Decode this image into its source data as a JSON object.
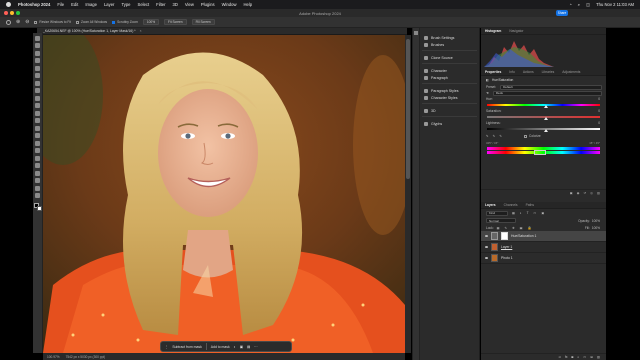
{
  "menubar": {
    "app": "Photoshop 2024",
    "items": [
      "File",
      "Edit",
      "Image",
      "Layer",
      "Type",
      "Select",
      "Filter",
      "3D",
      "View",
      "Plugins",
      "Window",
      "Help"
    ],
    "datetime": "Thu Nov 2  11:03 AM"
  },
  "window": {
    "title": "Adobe Photoshop 2024",
    "share_label": "Share"
  },
  "options_bar": {
    "resize_windows": "Resize Windows to Fit",
    "zoom_all_windows": "Zoom All Windows",
    "scrubby_zoom": "Scrubby Zoom",
    "zoom_value": "100%",
    "fit_screen": "Fit Screen",
    "fill_screen": "Fill Screen"
  },
  "document_tab": {
    "label": "_KA20654.NEF @ 100% (Hue/Saturation 1, Layer Mask/16) *"
  },
  "left_panels": [
    {
      "label": "Brush Settings",
      "icon": "brush-settings-icon"
    },
    {
      "label": "Brushes",
      "icon": "brushes-icon"
    },
    {
      "label": "Clone Source",
      "icon": "clone-source-icon"
    },
    {
      "label": "Character",
      "icon": "character-icon"
    },
    {
      "label": "Paragraph",
      "icon": "paragraph-icon"
    },
    {
      "label": "Paragraph Styles",
      "icon": "paragraph-styles-icon"
    },
    {
      "label": "Character Styles",
      "icon": "character-styles-icon"
    },
    {
      "label": "3D",
      "icon": "3d-icon"
    },
    {
      "label": "Glyphs",
      "icon": "glyphs-icon"
    }
  ],
  "histogram_tabs": [
    "Histogram",
    "Navigator"
  ],
  "properties": {
    "tabs": [
      "Properties",
      "Info",
      "Actions",
      "Libraries",
      "Adjustments"
    ],
    "title": "Hue/Saturation",
    "preset_label": "Preset:",
    "preset_value": "Default",
    "channel_value": "Reds",
    "hue_label": "Hue:",
    "hue_value": "0",
    "saturation_label": "Saturation:",
    "saturation_value": "0",
    "lightness_label": "Lightness:",
    "lightness_value": "0",
    "colorize_label": "Colorize",
    "range_left": "345° / 15°",
    "range_right": "15° \\ 45°"
  },
  "layers_panel": {
    "tabs": [
      "Layers",
      "Channels",
      "Paths"
    ],
    "kind_label": "Kind",
    "blend_mode": "Normal",
    "opacity_label": "Opacity:",
    "opacity_value": "100%",
    "lock_label": "Lock:",
    "fill_label": "Fill:",
    "fill_value": "100%",
    "layers": [
      {
        "name": "Hue/Saturation 1"
      },
      {
        "name": "Layer 1"
      },
      {
        "name": "Photo 1"
      }
    ]
  },
  "contextual_taskbar": {
    "subtract": "Subtract from mask",
    "add": "Add to mask"
  },
  "status": {
    "zoom": "100.97%",
    "info": "7542 px x 5030 px (300 ppi)"
  },
  "colors": {
    "accent": "#1473e6",
    "panel": "#2b2b2b",
    "background": "#000000"
  }
}
